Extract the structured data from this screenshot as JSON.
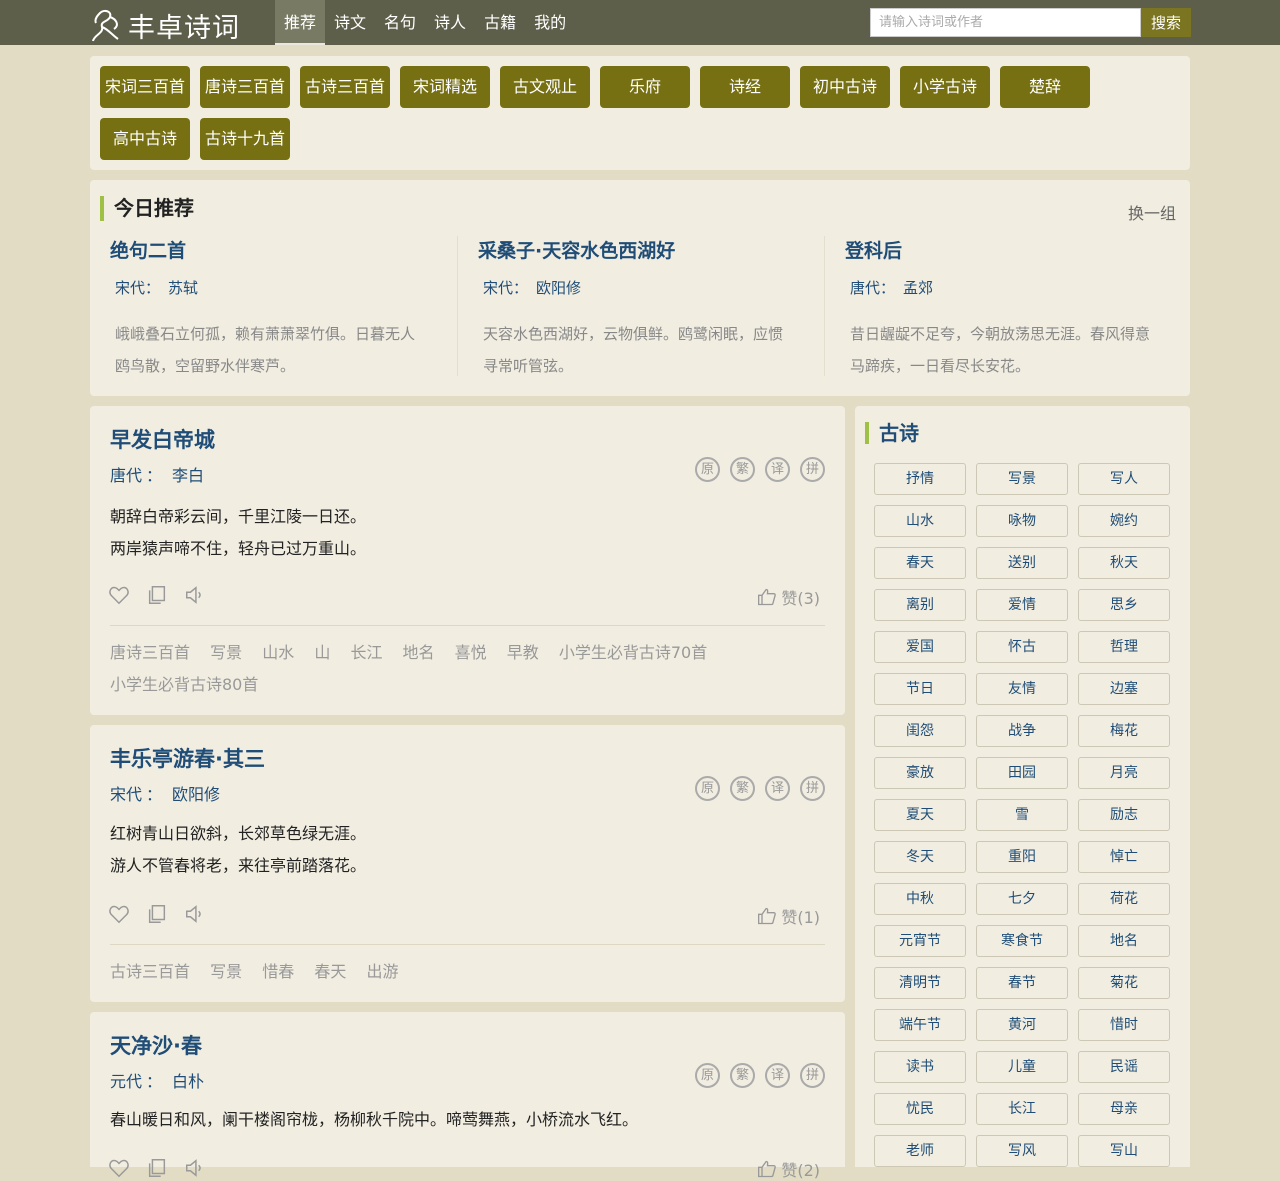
{
  "header": {
    "logo_text": "丰卓诗词",
    "nav": [
      "推荐",
      "诗文",
      "名句",
      "诗人",
      "古籍",
      "我的"
    ],
    "search_placeholder": "请输入诗词或作者",
    "search_button": "搜索"
  },
  "categories": [
    "宋词三百首",
    "唐诗三百首",
    "古诗三百首",
    "宋词精选",
    "古文观止",
    "乐府",
    "诗经",
    "初中古诗",
    "小学古诗",
    "楚辞",
    "高中古诗",
    "古诗十九首"
  ],
  "recommend": {
    "title": "今日推荐",
    "switch": "换一组",
    "items": [
      {
        "title": "绝句二首",
        "dynasty": "宋代：",
        "author": "苏轼",
        "content": "峨峨叠石立何孤，赖有萧萧翠竹俱。日暮无人鸥鸟散，空留野水伴寒芦。"
      },
      {
        "title": "采桑子·天容水色西湖好",
        "dynasty": "宋代：",
        "author": "欧阳修",
        "content": "天容水色西湖好，云物俱鲜。鸥鹭闲眠，应惯寻常听管弦。"
      },
      {
        "title": "登科后",
        "dynasty": "唐代：",
        "author": "孟郊",
        "content": "昔日龌龊不足夸，今朝放荡思无涯。春风得意马蹄疾，一日看尽长安花。"
      }
    ]
  },
  "poem_icons": [
    "原",
    "繁",
    "译",
    "拼"
  ],
  "poems": [
    {
      "title": "早发白帝城",
      "dynasty": "唐代",
      "sep": "：",
      "author": "李白",
      "lines": [
        "朝辞白帝彩云间，千里江陵一日还。",
        "两岸猿声啼不住，轻舟已过万重山。"
      ],
      "like": "赞(3)",
      "tags": [
        "唐诗三百首",
        "写景",
        "山水",
        "山",
        "长江",
        "地名",
        "喜悦",
        "早教",
        "小学生必背古诗70首",
        "小学生必背古诗80首"
      ]
    },
    {
      "title": "丰乐亭游春·其三",
      "dynasty": "宋代",
      "sep": "：",
      "author": "欧阳修",
      "lines": [
        "红树青山日欲斜，长郊草色绿无涯。",
        "游人不管春将老，来往亭前踏落花。"
      ],
      "like": "赞(1)",
      "tags": [
        "古诗三百首",
        "写景",
        "惜春",
        "春天",
        "出游"
      ]
    },
    {
      "title": "天净沙·春",
      "dynasty": "元代",
      "sep": "：",
      "author": "白朴",
      "lines": [
        "春山暖日和风，阑干楼阁帘栊，杨柳秋千院中。啼莺舞燕，小桥流水飞红。"
      ],
      "like": "赞(2)",
      "tags": []
    }
  ],
  "sidebar": {
    "title": "古诗",
    "tags": [
      "抒情",
      "写景",
      "写人",
      "山水",
      "咏物",
      "婉约",
      "春天",
      "送别",
      "秋天",
      "离别",
      "爱情",
      "思乡",
      "爱国",
      "怀古",
      "哲理",
      "节日",
      "友情",
      "边塞",
      "闺怨",
      "战争",
      "梅花",
      "豪放",
      "田园",
      "月亮",
      "夏天",
      "雪",
      "励志",
      "冬天",
      "重阳",
      "悼亡",
      "中秋",
      "七夕",
      "荷花",
      "元宵节",
      "寒食节",
      "地名",
      "清明节",
      "春节",
      "菊花",
      "端午节",
      "黄河",
      "惜时",
      "读书",
      "儿童",
      "民谣",
      "忧民",
      "长江",
      "母亲",
      "老师",
      "写风",
      "写山"
    ]
  }
}
